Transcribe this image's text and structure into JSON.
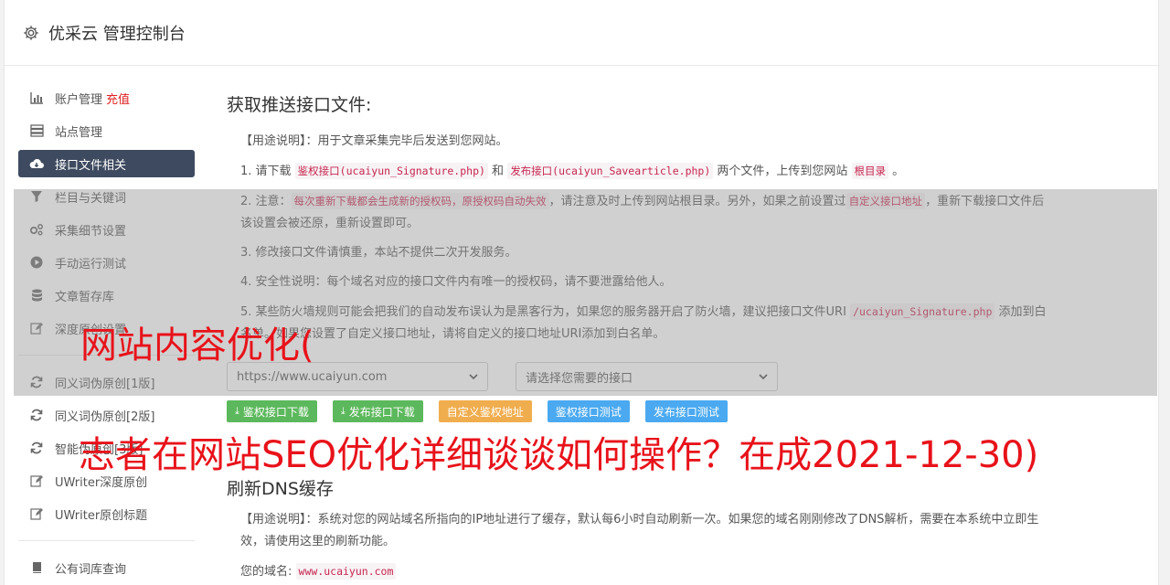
{
  "header": {
    "title": "优采云 管理控制台",
    "icon": "gear-icon"
  },
  "sidebar": {
    "items": [
      {
        "label": "账户管理",
        "extra": "充值",
        "icon": "bar-chart-icon"
      },
      {
        "label": "站点管理",
        "icon": "server-icon"
      },
      {
        "label": "接口文件相关",
        "icon": "cloud-download-icon"
      },
      {
        "label": "栏目与关键词",
        "icon": "filter-icon"
      },
      {
        "label": "采集细节设置",
        "icon": "cogs-icon"
      },
      {
        "label": "手动运行测试",
        "icon": "play-circle-icon"
      },
      {
        "label": "文章暂存库",
        "icon": "database-icon"
      },
      {
        "label": "深度原创设置",
        "icon": "edit-icon"
      }
    ],
    "items2": [
      {
        "label": "同义词伪原创[1版]",
        "icon": "refresh-icon"
      },
      {
        "label": "同义词伪原创[2版]",
        "icon": "refresh-icon"
      },
      {
        "label": "智能伪原创[3版]",
        "icon": "refresh-icon"
      },
      {
        "label": "UWriter深度原创",
        "icon": "edit-icon"
      },
      {
        "label": "UWriter原创标题",
        "icon": "edit-icon"
      }
    ],
    "items3": [
      {
        "label": "公有词库查询",
        "icon": "book-icon"
      }
    ]
  },
  "section1": {
    "title": "获取推送接口文件:",
    "usage": "【用途说明】：用于文章采集完毕后发送到您网站。",
    "step1": {
      "a": "1. 请下载 ",
      "c1": "鉴权接口(ucaiyun_Signature.php)",
      "b": " 和 ",
      "c2": "发布接口(ucaiyun_Savearticle.php)",
      "d": " 两个文件，上传到您网站 ",
      "c3": "根目录",
      "e": " 。"
    },
    "step2": {
      "a": "2. 注意：",
      "c1": "每次重新下载都会生成新的授权码，原授权码自动失效",
      "b": "，请注意及时上传到网站根目录。另外，如果之前设置过",
      "c2": "自定义接口地址",
      "d": "，重新下载接口文件后该设置会被还原，重新设置即可。"
    },
    "step3": "3. 修改接口文件请慎重，本站不提供二次开发服务。",
    "step4": "4. 安全性说明：每个域名对应的接口文件内有唯一的授权码，请不要泄露给他人。",
    "step5": {
      "a": "5. 某些防火墙规则可能会把我们的自动发布误认为是黑客行为，如果您的服务器开启了防火墙，建议把接口文件URI ",
      "c1": "/ucaiyun_Signature.php",
      "b": " 添加到白名单。如果您设置了自定义接口地址，请将自定义的接口地址URI添加到白名单。"
    },
    "site_select": "https://www.ucaiyun.com",
    "api_select": "请选择您需要的接口",
    "buttons": [
      "鉴权接口下载",
      "发布接口下载",
      "自定义鉴权地址",
      "鉴权接口测试",
      "发布接口测试"
    ]
  },
  "section2": {
    "title": "刷新DNS缓存",
    "usage": "【用途说明】：系统对您的网站域名所指向的IP地址进行了缓存，默认每6小时自动刷新一次。如果您的域名刚刚修改了DNS解析，需要在本系统中立即生效，请使用这里的刷新功能。",
    "domain_label": "您的域名:",
    "domain_value": "www.ucaiyun.com"
  },
  "watermark": {
    "line1": "网站内容优化(",
    "line2": "志者在网站SEO优化详细谈谈如何操作？在成2021-12-30)"
  },
  "colors": {
    "active_nav": "#3e4a5f",
    "watermark": "#e8121a",
    "code": "#c7254e"
  }
}
